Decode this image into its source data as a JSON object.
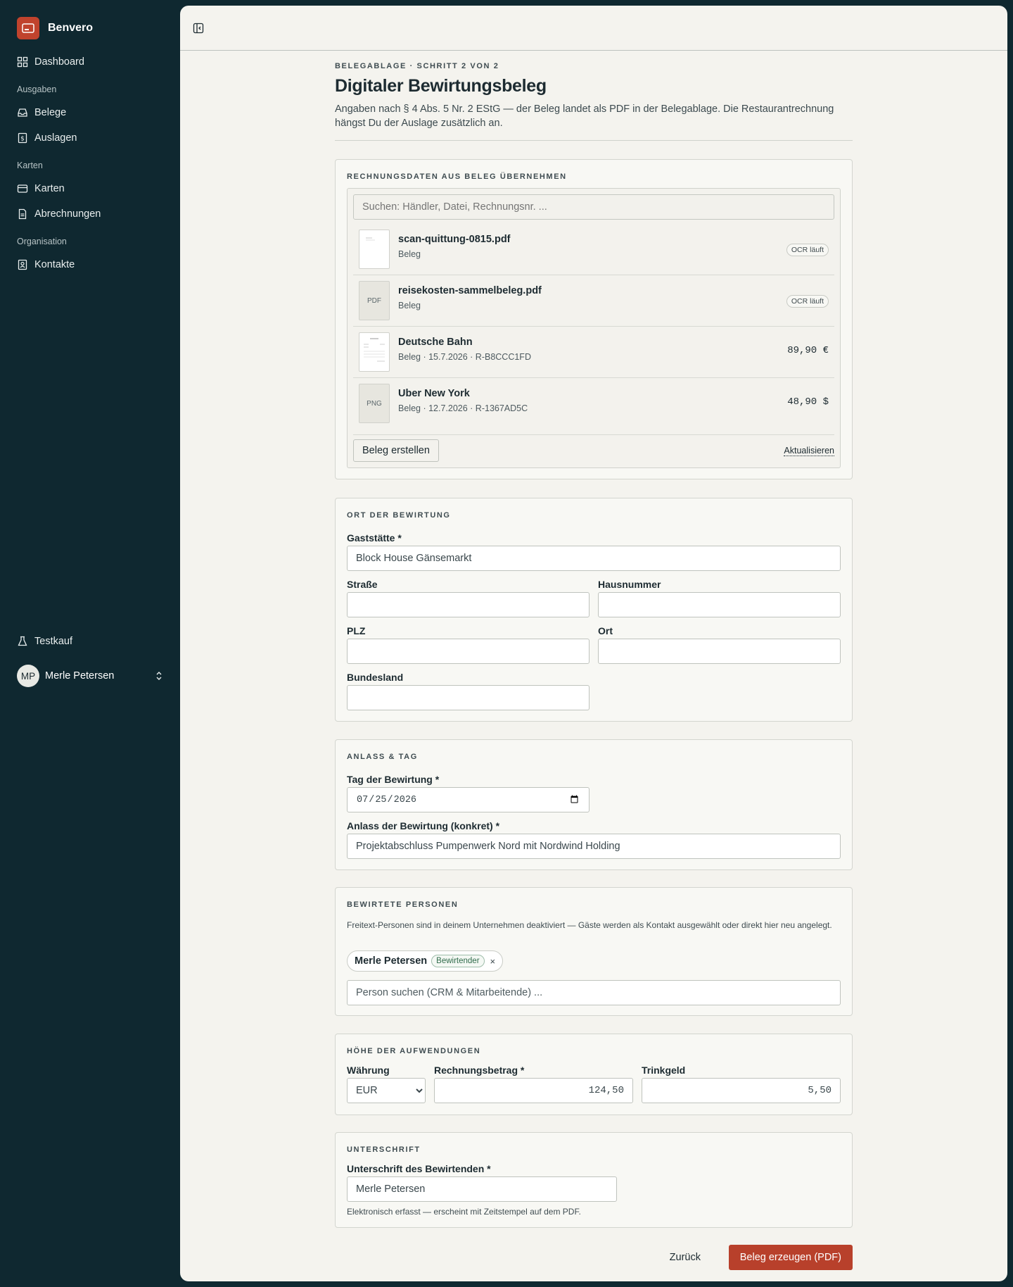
{
  "sidebar": {
    "brand": "Benvero",
    "dashboard": "Dashboard",
    "groups": {
      "ausgaben": "Ausgaben",
      "karten": "Karten",
      "organisation": "Organisation"
    },
    "items": {
      "belege": "Belege",
      "auslagen": "Auslagen",
      "karten": "Karten",
      "abrechnungen": "Abrechnungen",
      "kontakte": "Kontakte"
    },
    "testkauf": "Testkauf",
    "user": {
      "initials": "MP",
      "name": "Merle Petersen"
    }
  },
  "header": {
    "eyebrow": "Belegablage · Schritt 2 von 2",
    "title": "Digitaler Bewirtungsbeleg",
    "subtitle": "Angaben nach § 4 Abs. 5 Nr. 2 EStG — der Beleg landet als PDF in der Belegablage. Die Restaurantrechnung hängst Du der Auslage zusätzlich an."
  },
  "receipts": {
    "label": "Rechnungsdaten aus Beleg übernehmen",
    "search_placeholder": "Suchen: Händler, Datei, Rechnungsnr. ...",
    "rows": [
      {
        "name": "scan-quittung-0815.pdf",
        "meta": "Beleg",
        "badge": "OCR läuft",
        "thumb": ""
      },
      {
        "name": "reisekosten-sammelbeleg.pdf",
        "meta": "Beleg",
        "badge": "OCR läuft",
        "thumb": "PDF"
      },
      {
        "name": "Deutsche Bahn",
        "meta": "Beleg · 15.7.2026 · R-B8CCC1FD",
        "amount": "89,90 €",
        "thumb": ""
      },
      {
        "name": "Uber New York",
        "meta": "Beleg · 12.7.2026 · R-1367AD5C",
        "amount": "48,90 $",
        "thumb": "PNG"
      }
    ],
    "create_label": "Beleg erstellen",
    "refresh_label": "Aktualisieren"
  },
  "location": {
    "label": "Ort der Bewirtung",
    "venue_label": "Gaststätte *",
    "venue_value": "Block House Gänsemarkt",
    "street_label": "Straße",
    "number_label": "Hausnummer",
    "zip_label": "PLZ",
    "city_label": "Ort",
    "state_label": "Bundesland"
  },
  "occasion": {
    "label": "Anlass & Tag",
    "date_label": "Tag der Bewirtung *",
    "date_value": "2026-07-25",
    "reason_label": "Anlass der Bewirtung (konkret) *",
    "reason_value": "Projektabschluss Pumpenwerk Nord mit Nordwind Holding"
  },
  "guests": {
    "label": "Bewirtete Personen",
    "note": "Freitext-Personen sind in deinem Unternehmen deaktiviert — Gäste werden als Kontakt ausgewählt oder direkt hier neu angelegt.",
    "chip_name": "Merle Petersen",
    "chip_role": "Bewirtender",
    "chip_remove": "×",
    "search_placeholder": "Person suchen (CRM & Mitarbeitende) ..."
  },
  "amounts": {
    "label": "Höhe der Aufwendungen",
    "currency_label": "Währung",
    "currency_value": "EUR",
    "invoice_label": "Rechnungsbetrag *",
    "invoice_value": "124,50",
    "tip_label": "Trinkgeld",
    "tip_value": "5,50"
  },
  "signature": {
    "label": "Unterschrift",
    "field_label": "Unterschrift des Bewirtenden *",
    "value": "Merle Petersen",
    "note": "Elektronisch erfasst — erscheint mit Zeitstempel auf dem PDF."
  },
  "actions": {
    "back": "Zurück",
    "submit": "Beleg erzeugen (PDF)"
  },
  "colors": {
    "sidebar_bg": "#0f2830",
    "primary": "#b8402b",
    "panel_bg": "#f4f3ee"
  }
}
